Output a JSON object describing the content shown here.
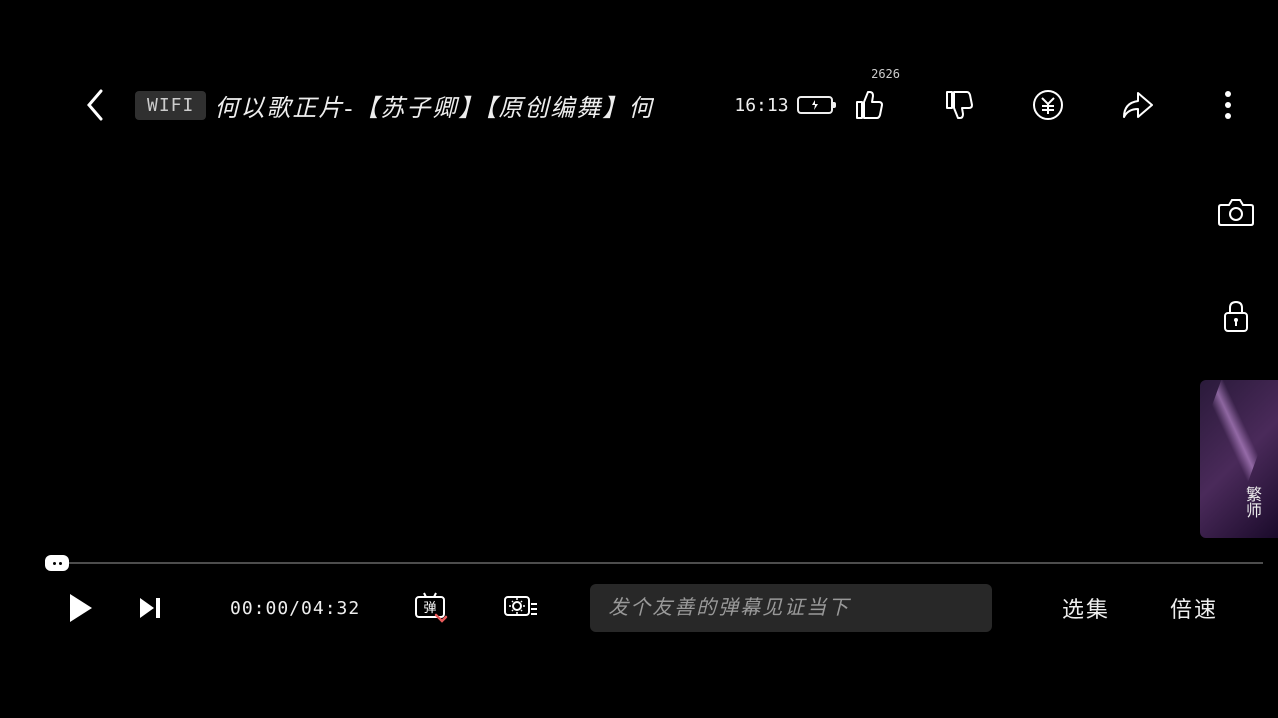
{
  "header": {
    "wifi_label": "WIFI",
    "title": "何以歌正片-【苏子卿】【原创编舞】何",
    "clock": "16:13",
    "like_count": "2626"
  },
  "episode_preview": {
    "label": "繁师"
  },
  "playback": {
    "current_time": "00:00",
    "duration": "04:32",
    "time_display": "00:00/04:32"
  },
  "danmu": {
    "placeholder": "发个友善的弹幕见证当下"
  },
  "controls": {
    "episodes_label": "选集",
    "speed_label": "倍速"
  }
}
